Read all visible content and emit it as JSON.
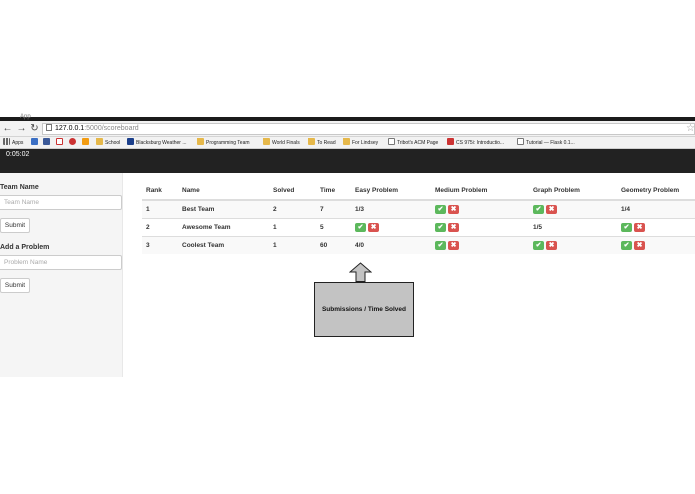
{
  "browser": {
    "tab_label": "App",
    "url_host": "127.0.0.1",
    "url_path": ":5000/scoreboard",
    "bookmarks": [
      {
        "label": "Apps",
        "icon": "apps-grid-icon"
      },
      {
        "label": "",
        "icon": "blue-app-icon"
      },
      {
        "label": "",
        "icon": "facebook-icon"
      },
      {
        "label": "",
        "icon": "gmail-icon"
      },
      {
        "label": "",
        "icon": "red-s-icon"
      },
      {
        "label": "",
        "icon": "orange-app-icon"
      },
      {
        "label": "School",
        "icon": "folder-icon"
      },
      {
        "label": "Blacksburg Weather ...",
        "icon": "twc-icon"
      },
      {
        "label": "Programming Team",
        "icon": "folder-icon"
      },
      {
        "label": "World Finals",
        "icon": "folder-icon"
      },
      {
        "label": "To Read",
        "icon": "folder-icon"
      },
      {
        "label": "For Lindsey",
        "icon": "folder-icon"
      },
      {
        "label": "Tribot's ACM Page",
        "icon": "page-icon"
      },
      {
        "label": "CS 975i: Introductio...",
        "icon": "red-s-icon"
      },
      {
        "label": "Tutorial — Flask 0.1...",
        "icon": "page-icon"
      }
    ]
  },
  "timer": "0:05:02",
  "sidebar": {
    "team_label": "Team Name",
    "team_placeholder": "Team Name",
    "submit1": "Submit",
    "problem_label": "Add a Problem",
    "problem_placeholder": "Problem Name",
    "submit2": "Submit"
  },
  "table": {
    "headers": [
      "Rank",
      "Name",
      "Solved",
      "Time",
      "Easy Problem",
      "Medium Problem",
      "Graph Problem",
      "Geometry Problem"
    ],
    "rows": [
      {
        "rank": "1",
        "name": "Best Team",
        "solved": "2",
        "time": "7",
        "easy": "1/3",
        "medium": "",
        "graph": "",
        "geometry": "1/4"
      },
      {
        "rank": "2",
        "name": "Awesome Team",
        "solved": "1",
        "time": "5",
        "easy": "",
        "medium": "",
        "graph": "1/5",
        "geometry": ""
      },
      {
        "rank": "3",
        "name": "Coolest Team",
        "solved": "1",
        "time": "60",
        "easy": "4/0",
        "medium": "",
        "graph": "",
        "geometry": ""
      }
    ]
  },
  "callout": "Submissions / Time Solved",
  "colors": {
    "accent_green": "#5cb85c",
    "accent_red": "#d9534f",
    "header_dark": "#222222"
  }
}
